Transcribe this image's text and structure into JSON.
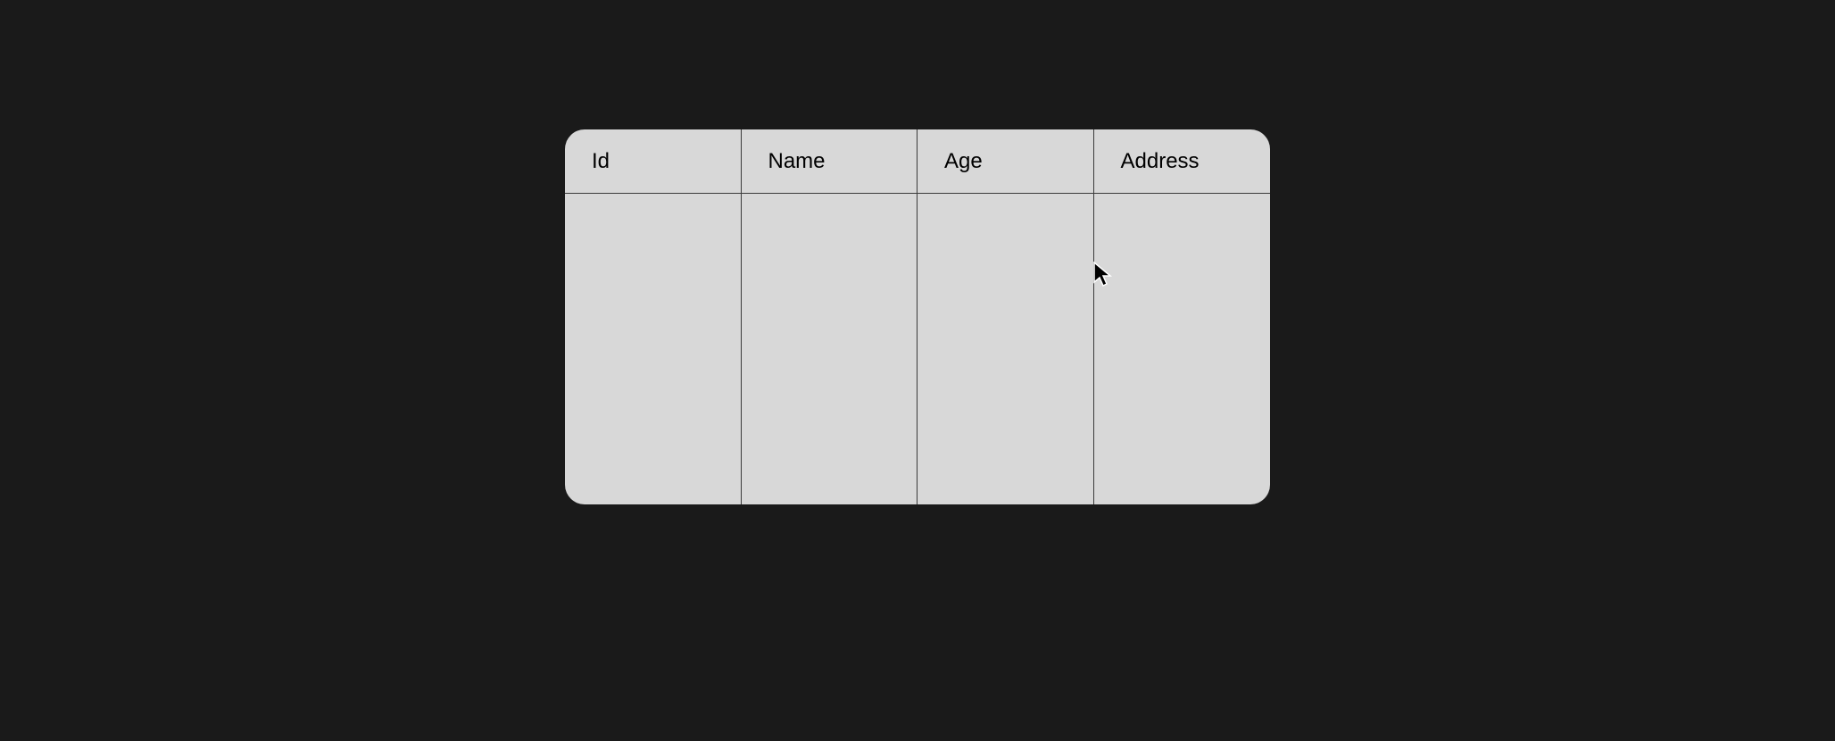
{
  "table": {
    "columns": [
      {
        "label": "Id"
      },
      {
        "label": "Name"
      },
      {
        "label": "Age"
      },
      {
        "label": "Address"
      }
    ]
  }
}
